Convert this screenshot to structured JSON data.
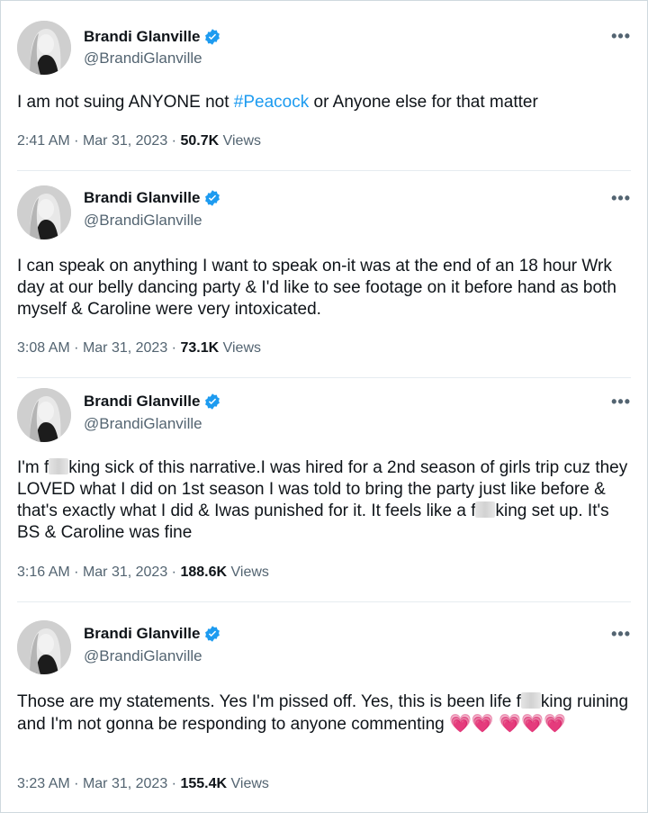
{
  "author": {
    "name": "Brandi Glanville",
    "handle": "@BrandiGlanville",
    "avatar_icon": "profile-photo",
    "verified_icon": "verified-badge-icon",
    "verified_color": "#1d9bf0"
  },
  "colors": {
    "text": "#0f1419",
    "muted": "#536471",
    "link": "#1d9bf0",
    "divider": "#e6ecf0",
    "heart": "#e0245e"
  },
  "tweets": [
    {
      "text_before": "I am not suing ANYONE not ",
      "hashtag": "#Peacock",
      "text_after": " or Anyone else for that matter",
      "time": "2:41 AM",
      "date": "Mar 31, 2023",
      "views_count": "50.7K",
      "views_label": "Views"
    },
    {
      "text": "I can speak on anything I want to speak on-it was at the end of an 18 hour Wrk day at our belly dancing party & I'd like to see footage on it before hand as both myself & Caroline were very intoxicated.",
      "time": "3:08 AM",
      "date": "Mar 31, 2023",
      "views_count": "73.1K",
      "views_label": "Views"
    },
    {
      "p1": "I'm f",
      "p2": "king sick of this narrative.I was hired for a 2nd season of girls trip cuz they LOVED what I did on 1st season I was told to bring the party just like before & that's exactly what I did & Iwas punished for it. It feels like a f",
      "p3": "king set up. It's BS & Caroline was fine",
      "time": "3:16 AM",
      "date": "Mar 31, 2023",
      "views_count": "188.6K",
      "views_label": "Views"
    },
    {
      "p1": "Those are my statements. Yes I'm pissed off. Yes, this is been life f",
      "p2": "king ruining and I'm not gonna be responding to anyone commenting ",
      "hearts": "💗💗 💗💗💗",
      "time": "3:23 AM",
      "date": "Mar 31, 2023",
      "views_count": "155.4K",
      "views_label": "Views"
    }
  ],
  "separator": "·",
  "more_label": "•••"
}
